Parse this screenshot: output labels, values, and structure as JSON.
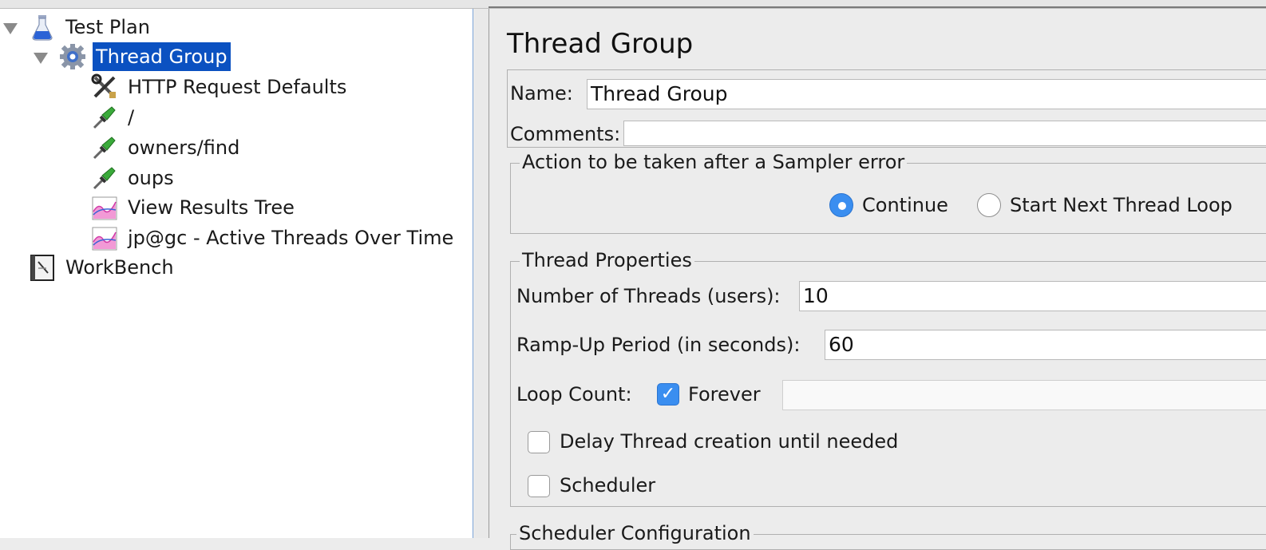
{
  "tree": {
    "items": [
      {
        "label": "Test Plan",
        "icon": "flask-icon"
      },
      {
        "label": "Thread Group",
        "icon": "gear-icon",
        "selected": true
      },
      {
        "label": "HTTP Request Defaults",
        "icon": "tools-icon"
      },
      {
        "label": "/",
        "icon": "pipette-icon"
      },
      {
        "label": "owners/find",
        "icon": "pipette-icon"
      },
      {
        "label": "oups",
        "icon": "pipette-icon"
      },
      {
        "label": "View Results Tree",
        "icon": "graph-icon"
      },
      {
        "label": "jp@gc - Active Threads Over Time",
        "icon": "graph-icon"
      },
      {
        "label": "WorkBench",
        "icon": "notebook-icon"
      }
    ]
  },
  "panel": {
    "title": "Thread Group",
    "name_label": "Name:",
    "name_value": "Thread Group",
    "comments_label": "Comments:",
    "comments_value": "",
    "error_action": {
      "legend": "Action to be taken after a Sampler error",
      "options": [
        "Continue",
        "Start Next Thread Loop"
      ],
      "selected": "Continue"
    },
    "thread_props": {
      "legend": "Thread Properties",
      "threads_label": "Number of Threads (users):",
      "threads_value": "10",
      "rampup_label": "Ramp-Up Period (in seconds):",
      "rampup_value": "60",
      "loop_label": "Loop Count:",
      "forever_label": "Forever",
      "forever_checked": true,
      "loop_value": "",
      "delay_label": "Delay Thread creation until needed",
      "delay_checked": false,
      "scheduler_label": "Scheduler",
      "scheduler_checked": false
    },
    "scheduler_config_legend": "Scheduler Configuration"
  },
  "colors": {
    "selection": "#0b51c1",
    "accent": "#3a8ef0"
  }
}
